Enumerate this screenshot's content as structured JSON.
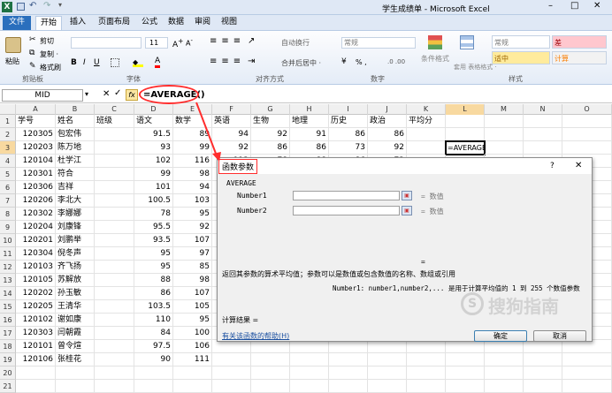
{
  "window": {
    "title": "学生成绩单 - Microsoft Excel",
    "minimize": "–",
    "maximize": "□",
    "close": "✕"
  },
  "tabs": {
    "file": "文件",
    "home": "开始",
    "insert": "插入",
    "page_layout": "页面布局",
    "formulas": "公式",
    "data": "数据",
    "review": "审阅",
    "view": "视图"
  },
  "ribbon": {
    "paste": "粘贴",
    "cut": "剪切",
    "copy": "复制 ·",
    "format_painter": "格式刷",
    "font_size": "11",
    "wrap_text": "自动换行",
    "merge_center": "合并后居中 ·",
    "number_format": "常规",
    "percent": "% ,",
    "conditional_format": "条件格式",
    "table_format": "套用 表格格式 ·",
    "style_normal": "常规",
    "style_bad": "差",
    "style_neutral": "适中",
    "style_calc": "计算",
    "group_clipboard": "剪贴板",
    "group_font": "字体",
    "group_alignment": "对齐方式",
    "group_number": "数字",
    "group_styles": "样式"
  },
  "formula_bar": {
    "name_box": "MID",
    "fx": "fx",
    "formula": "=AVERAGE()"
  },
  "columns": [
    "A",
    "B",
    "C",
    "D",
    "E",
    "F",
    "G",
    "H",
    "I",
    "J",
    "K",
    "L",
    "M",
    "N",
    "O"
  ],
  "rows": [
    {
      "n": "1",
      "c": [
        "学号",
        "姓名",
        "班级",
        "语文",
        "数学",
        "英语",
        "生物",
        "地理",
        "历史",
        "政治",
        "平均分",
        "",
        "",
        "",
        ""
      ]
    },
    {
      "n": "2",
      "c": [
        "120305",
        "包宏伟",
        "",
        "91.5",
        "89",
        "94",
        "92",
        "91",
        "86",
        "86",
        "",
        "",
        "",
        "",
        ""
      ]
    },
    {
      "n": "3",
      "c": [
        "120203",
        "陈万地",
        "",
        "93",
        "99",
        "92",
        "86",
        "86",
        "73",
        "92",
        "",
        "=AVERAGE()",
        "",
        "",
        ""
      ]
    },
    {
      "n": "4",
      "c": [
        "120104",
        "杜学江",
        "",
        "102",
        "116",
        "113",
        "78",
        "88",
        "86",
        "73",
        "",
        "",
        "",
        "",
        ""
      ]
    },
    {
      "n": "5",
      "c": [
        "120301",
        "符合",
        "",
        "99",
        "98",
        "",
        "",
        "",
        "",
        "",
        "",
        "",
        "",
        "",
        ""
      ]
    },
    {
      "n": "6",
      "c": [
        "120306",
        "吉祥",
        "",
        "101",
        "94",
        "",
        "",
        "",
        "",
        "",
        "",
        "",
        "",
        "",
        ""
      ]
    },
    {
      "n": "7",
      "c": [
        "120206",
        "李北大",
        "",
        "100.5",
        "103",
        "",
        "",
        "",
        "",
        "",
        "",
        "",
        "",
        "",
        ""
      ]
    },
    {
      "n": "8",
      "c": [
        "120302",
        "李娜娜",
        "",
        "78",
        "95",
        "",
        "",
        "",
        "",
        "",
        "",
        "",
        "",
        "",
        ""
      ]
    },
    {
      "n": "9",
      "c": [
        "120204",
        "刘康锋",
        "",
        "95.5",
        "92",
        "",
        "",
        "",
        "",
        "",
        "",
        "",
        "",
        "",
        ""
      ]
    },
    {
      "n": "10",
      "c": [
        "120201",
        "刘鹏举",
        "",
        "93.5",
        "107",
        "",
        "",
        "",
        "",
        "",
        "",
        "",
        "",
        "",
        ""
      ]
    },
    {
      "n": "11",
      "c": [
        "120304",
        "倪冬声",
        "",
        "95",
        "97",
        "",
        "",
        "",
        "",
        "",
        "",
        "",
        "",
        "",
        ""
      ]
    },
    {
      "n": "12",
      "c": [
        "120103",
        "齐飞扬",
        "",
        "95",
        "85",
        "",
        "",
        "",
        "",
        "",
        "",
        "",
        "",
        "",
        ""
      ]
    },
    {
      "n": "13",
      "c": [
        "120105",
        "苏解放",
        "",
        "88",
        "98",
        "",
        "",
        "",
        "",
        "",
        "",
        "",
        "",
        "",
        ""
      ]
    },
    {
      "n": "14",
      "c": [
        "120202",
        "孙玉敏",
        "",
        "86",
        "107",
        "",
        "",
        "",
        "",
        "",
        "",
        "",
        "",
        "",
        ""
      ]
    },
    {
      "n": "15",
      "c": [
        "120205",
        "王清华",
        "",
        "103.5",
        "105",
        "",
        "",
        "",
        "",
        "",
        "",
        "",
        "",
        "",
        ""
      ]
    },
    {
      "n": "16",
      "c": [
        "120102",
        "谢如康",
        "",
        "110",
        "95",
        "",
        "",
        "",
        "",
        "",
        "",
        "",
        "",
        "",
        ""
      ]
    },
    {
      "n": "17",
      "c": [
        "120303",
        "闫朝霞",
        "",
        "84",
        "100",
        "",
        "",
        "",
        "",
        "",
        "",
        "",
        "",
        "",
        ""
      ]
    },
    {
      "n": "18",
      "c": [
        "120101",
        "曾令煊",
        "",
        "97.5",
        "106",
        "",
        "",
        "",
        "",
        "",
        "",
        "",
        "",
        "",
        ""
      ]
    },
    {
      "n": "19",
      "c": [
        "120106",
        "张桂花",
        "",
        "90",
        "111",
        "",
        "",
        "",
        "",
        "",
        "",
        "",
        "",
        "",
        ""
      ]
    },
    {
      "n": "20",
      "c": [
        "",
        "",
        "",
        "",
        "",
        "",
        "",
        "",
        "",
        "",
        "",
        "",
        "",
        "",
        ""
      ]
    },
    {
      "n": "21",
      "c": [
        "",
        "",
        "",
        "",
        "",
        "",
        "",
        "",
        "",
        "",
        "",
        "",
        "",
        "",
        ""
      ]
    }
  ],
  "dialog": {
    "title": "函数参数",
    "help_q": "?",
    "close": "✕",
    "function_name": "AVERAGE",
    "arg1_label": "Number1",
    "arg1_hint": "= 数值",
    "arg2_label": "Number2",
    "arg2_hint": "= 数值",
    "result_eq": "=",
    "description": "返回其参数的算术平均值；参数可以是数值或包含数值的名称、数组或引用",
    "arg_desc": "Number1:  number1,number2,... 是用于计算平均值的 1 到 255 个数值参数",
    "calc_result": "计算结果 =",
    "help_link": "有关该函数的帮助(H)",
    "ok": "确定",
    "cancel": "取消"
  },
  "watermark": "搜狗指南",
  "colors": {
    "accent_red": "#ff2d2d",
    "file_tab": "#2a6fbd"
  }
}
